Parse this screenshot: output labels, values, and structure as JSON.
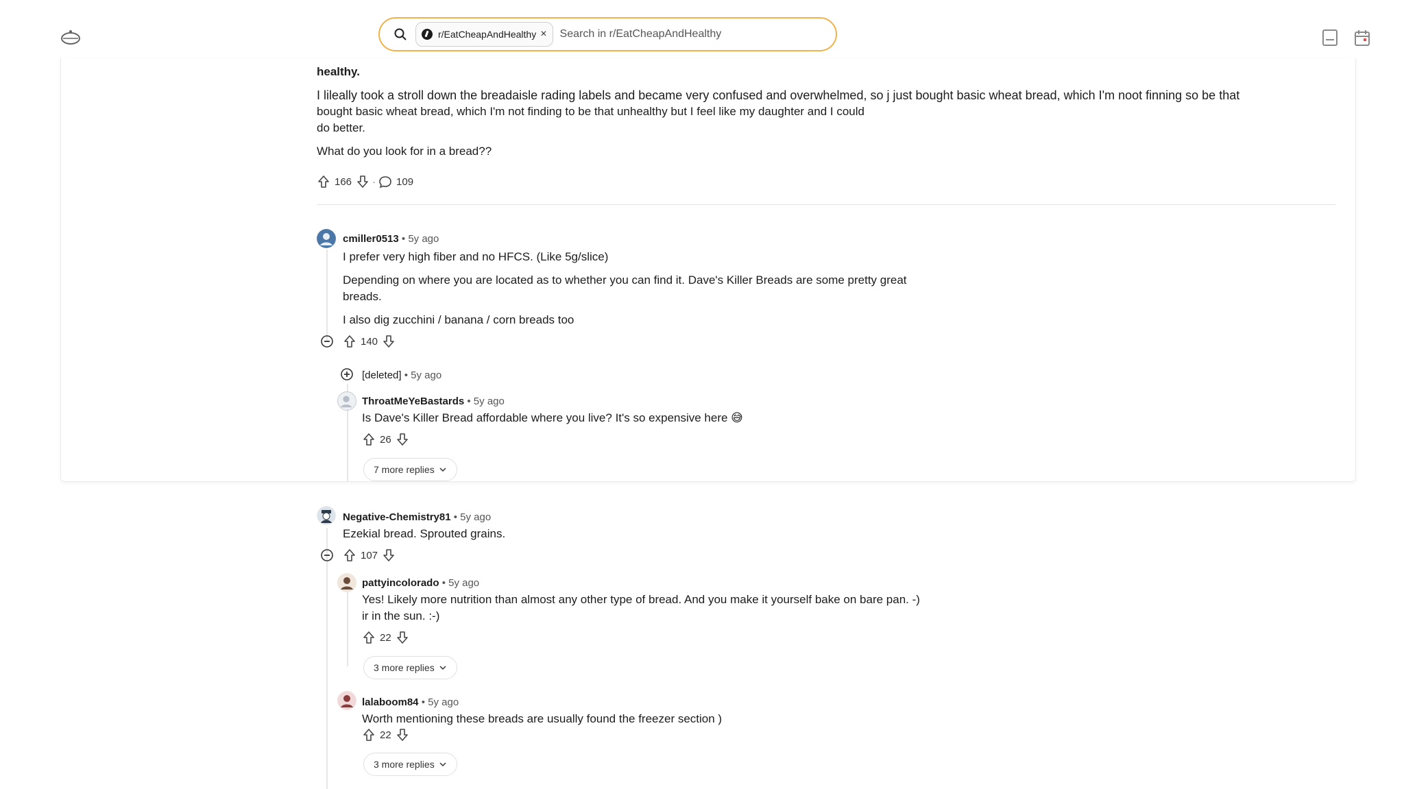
{
  "header": {
    "subreddit_chip": "r/EatCheapAndHealthy",
    "chip_close": "×",
    "search_placeholder": "Search in r/EatCheapAndHealthy"
  },
  "post": {
    "line_top": "healthy.",
    "body_line1": "I lileally took a stroll down the breadaisle rading labels and became very confused and overwhelmed, so j just bought basic wheat bread, which I'm noot finning so be that",
    "body_line2": "bought basic wheat bread, which I'm not finding to be that unhealthy but I feel like my daughter and I could",
    "body_line3": "do better.",
    "question": "What do you look for in a bread??",
    "upvotes": "166",
    "comments": "109"
  },
  "comments": [
    {
      "user": "cmiller0513",
      "time": "• 5y ago",
      "line1": "I prefer very high fiber and no HFCS. (Like 5g/slice)",
      "line2": "Depending on where you are located as to whether you can find it. Dave's Killer Breads are some pretty great",
      "line3": "breads.",
      "line4": "I also dig zucchini / banana / corn breads too",
      "score": "140"
    },
    {
      "user": "[deleted]",
      "time": "• 5y ago"
    },
    {
      "user": "ThroatMeYeBastards",
      "time": "• 5y ago",
      "line1": "Is Dave's Killer Bread affordable where you live? It's so expensive here 😅",
      "score": "26",
      "more": "7 more replies"
    },
    {
      "user": "Negative-Chemistry81",
      "time": "• 5y ago",
      "line1": "Ezekial bread. Sprouted grains.",
      "score": "107"
    },
    {
      "user": "pattyincolorado",
      "time": "• 5y ago",
      "line1": "Yes! Likely more nutrition than almost any other type of bread. And you make it yourself bake on bare pan. -)",
      "line2": "ir in the sun. :-)",
      "score": "22",
      "more": "3 more replies"
    },
    {
      "user": "lalaboom84",
      "time": "• 5y ago",
      "line1": "Worth mentioning these breads are usually found the freezer section )",
      "score": "22",
      "more": "3 more replies"
    }
  ]
}
